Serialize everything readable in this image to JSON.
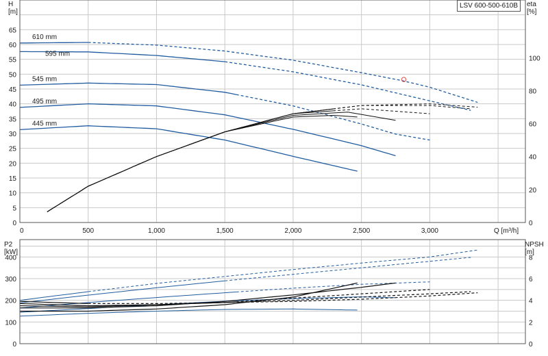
{
  "model_label": "LSV 600-500-610B",
  "colors": {
    "blue": "#1f5b9e",
    "blue_dashed": "#2b63a8",
    "black": "#111111",
    "marker": "#d9534f"
  },
  "chart_data": [
    {
      "type": "line",
      "title": "",
      "xlabel": "Q [m³/h]",
      "ylabel": "H\n[m]",
      "y2label": "eta\n[%]",
      "xlim": [
        0,
        3700
      ],
      "ylim": [
        0,
        75
      ],
      "y2lim": [
        0,
        135
      ],
      "grid": true,
      "x_ticks": [
        0,
        500,
        1000,
        1500,
        2000,
        2500,
        3000
      ],
      "x_tick_labels": [
        "0",
        "500",
        "1,000",
        "1,500",
        "2,000",
        "2,500",
        "3,000"
      ],
      "y_ticks": [
        0,
        5,
        10,
        15,
        20,
        25,
        30,
        35,
        40,
        45,
        50,
        55,
        60,
        65
      ],
      "y2_ticks": [
        0,
        20,
        40,
        60,
        80,
        100
      ],
      "series": [
        {
          "name": "610 mm",
          "kind": "head",
          "x_solid_end": 500,
          "x": [
            0,
            500,
            1000,
            1500,
            2000,
            2500,
            2800,
            3000,
            3350
          ],
          "values": [
            60.5,
            60.7,
            59.8,
            57.8,
            54.7,
            50.5,
            47.8,
            45.6,
            40.5
          ]
        },
        {
          "name": "595 mm",
          "kind": "head",
          "x_solid_end": 1500,
          "x": [
            0,
            500,
            1000,
            1500,
            2000,
            2500,
            3000,
            3300
          ],
          "values": [
            57.6,
            57.5,
            56.3,
            54.2,
            50.8,
            46.4,
            41.0,
            37.8
          ]
        },
        {
          "name": "545 mm",
          "kind": "head",
          "x_solid_end": 1600,
          "x": [
            0,
            500,
            1000,
            1500,
            2000,
            2500,
            2750,
            3000
          ],
          "values": [
            46.3,
            47.0,
            46.5,
            43.9,
            39.3,
            33.2,
            29.8,
            27.8
          ]
        },
        {
          "name": "495 mm",
          "kind": "head",
          "x_solid_end": 2750,
          "x": [
            0,
            500,
            1000,
            1500,
            2000,
            2500,
            2750
          ],
          "values": [
            38.8,
            40.0,
            39.3,
            36.3,
            31.4,
            25.9,
            22.5
          ]
        },
        {
          "name": "445 mm",
          "kind": "head",
          "x_solid_end": 2470,
          "x": [
            0,
            500,
            1000,
            1500,
            2000,
            2470
          ],
          "values": [
            31.3,
            32.6,
            31.6,
            27.8,
            22.3,
            17.3
          ]
        }
      ],
      "efficiency_series": [
        {
          "x": [
            200,
            500,
            1000,
            1500,
            2000,
            2300,
            2470
          ],
          "values": [
            6.5,
            22,
            40,
            55,
            64,
            65,
            64
          ],
          "x_solid_end": 2470
        },
        {
          "x": [
            200,
            500,
            1000,
            1500,
            2000,
            2400,
            2750
          ],
          "values": [
            6.5,
            22,
            40,
            55,
            65,
            67,
            62
          ],
          "x_solid_end": 2750
        },
        {
          "x": [
            200,
            500,
            1000,
            1500,
            2000,
            2500,
            3000
          ],
          "values": [
            6.5,
            22,
            40,
            55,
            66,
            69,
            66
          ],
          "x_solid_end": 2300
        },
        {
          "x": [
            200,
            500,
            1000,
            1500,
            2000,
            2500,
            3000,
            3300
          ],
          "values": [
            6.5,
            22,
            40,
            55,
            66,
            71,
            71,
            69
          ],
          "x_solid_end": 2300
        },
        {
          "x": [
            200,
            500,
            1000,
            1500,
            2000,
            2500,
            3000,
            3350
          ],
          "values": [
            6.5,
            22,
            40,
            55,
            66,
            71,
            72,
            70
          ],
          "x_solid_end": 2300
        }
      ],
      "operating_point": {
        "x": 2810,
        "y": 48.2
      }
    },
    {
      "type": "line",
      "title": "",
      "xlabel": "",
      "ylabel": "P2\n[kW]",
      "y2label": "NPSH\n[m]",
      "xlim": [
        0,
        3700
      ],
      "ylim": [
        0,
        480
      ],
      "y2lim": [
        0,
        9.6
      ],
      "grid": true,
      "y_ticks": [
        0,
        100,
        200,
        300,
        400
      ],
      "y2_ticks": [
        0,
        2,
        4,
        6,
        8
      ],
      "power_series": [
        {
          "x": [
            0,
            500,
            1000,
            1500,
            2000,
            2500,
            3000,
            3350
          ],
          "values": [
            200,
            240,
            278,
            310,
            342,
            372,
            400,
            432
          ],
          "x_solid_end": 500
        },
        {
          "x": [
            0,
            500,
            1000,
            1500,
            2000,
            2500,
            3000,
            3300
          ],
          "values": [
            188,
            224,
            258,
            290,
            320,
            350,
            380,
            398
          ],
          "x_solid_end": 1500
        },
        {
          "x": [
            0,
            500,
            1000,
            1500,
            2000,
            2500,
            3000
          ],
          "values": [
            165,
            190,
            213,
            235,
            256,
            274,
            285
          ],
          "x_solid_end": 1600
        },
        {
          "x": [
            0,
            500,
            1000,
            1500,
            2000,
            2500,
            2750
          ],
          "values": [
            145,
            162,
            180,
            196,
            208,
            216,
            212
          ],
          "x_solid_end": 2750
        },
        {
          "x": [
            0,
            500,
            1000,
            1500,
            2000,
            2470
          ],
          "values": [
            127,
            140,
            150,
            158,
            160,
            155
          ],
          "x_solid_end": 2470
        }
      ],
      "npsh_series": [
        {
          "x": [
            0,
            500,
            1000,
            1500,
            2000,
            2470
          ],
          "values": [
            3.0,
            3.0,
            3.2,
            3.6,
            4.3,
            5.6
          ],
          "x_solid_end": 2470
        },
        {
          "x": [
            0,
            500,
            1000,
            1500,
            2000,
            2500,
            2750
          ],
          "values": [
            3.3,
            3.3,
            3.5,
            3.9,
            4.5,
            5.2,
            5.6
          ],
          "x_solid_end": 2750
        },
        {
          "x": [
            0,
            500,
            1000,
            1500,
            2000,
            2500,
            3000
          ],
          "values": [
            3.5,
            3.4,
            3.6,
            3.8,
            4.2,
            4.6,
            5.0
          ],
          "x_solid_end": 1600
        },
        {
          "x": [
            0,
            500,
            1000,
            1500,
            2000,
            2500,
            3000,
            3300
          ],
          "values": [
            3.7,
            3.5,
            3.6,
            3.8,
            4.0,
            4.3,
            4.6,
            4.8
          ],
          "x_solid_end": 1500
        },
        {
          "x": [
            0,
            500,
            1000,
            1500,
            2000,
            2500,
            3000,
            3350
          ],
          "values": [
            3.9,
            3.7,
            3.7,
            3.8,
            3.9,
            4.1,
            4.4,
            4.7
          ],
          "x_solid_end": 500
        }
      ]
    }
  ]
}
